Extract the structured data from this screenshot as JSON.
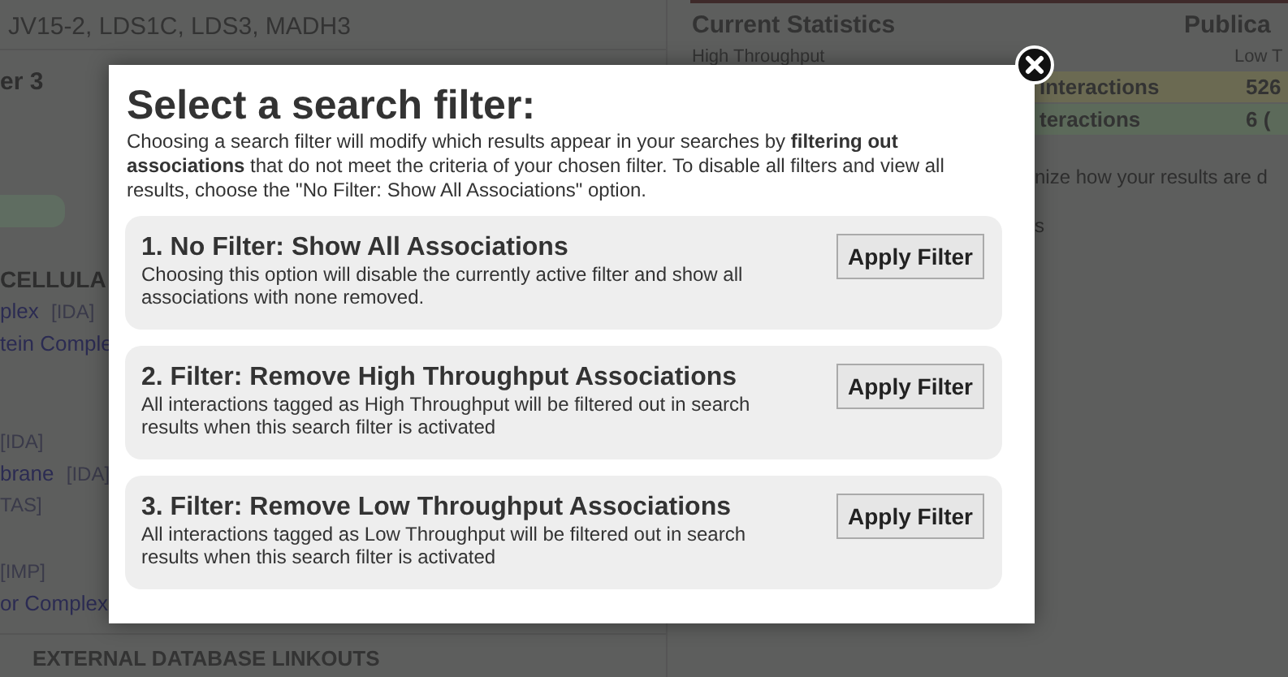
{
  "background": {
    "genes": "JV15-2, LDS1C, LDS3, MADH3",
    "section_fragment": "er 3",
    "ontology_heading": "CELLULA",
    "terms": [
      {
        "term": "plex",
        "evidence": "[IDA]"
      },
      {
        "term": "tein Comple"
      },
      {
        "evidence": "[IDA]"
      },
      {
        "term": "brane",
        "evidence": "[IDA]"
      },
      {
        "evidence": "TAS]"
      },
      {
        "evidence": "[IMP]"
      },
      {
        "term": "or Complex"
      }
    ],
    "external_heading": "EXTERNAL DATABASE LINKOUTS",
    "stats": {
      "title": "Current Statistics",
      "publications": "Publica",
      "high_label": "High Throughput",
      "low_label": "Low T",
      "rows": [
        {
          "label": "Interactions",
          "value": "526",
          "color": "#6b6a52"
        },
        {
          "label": "teractions",
          "value": "6 (",
          "color": "#5c6a5a"
        }
      ],
      "note": "nize how your results are d",
      "fragment": "s"
    }
  },
  "dialog": {
    "title": "Select a search filter:",
    "intro": "Choosing a search filter will modify which results appear in your searches by **filtering out associations** that do not meet the criteria of your chosen filter. To disable all filters and view all results, choose the \"No Filter: Show All Associations\" option.",
    "filters": [
      {
        "title": "1. No Filter: Show All Associations",
        "description": "Choosing this option will disable the currently active filter and show all associations with none removed.",
        "button": "Apply Filter"
      },
      {
        "title": "2. Filter: Remove High Throughput Associations",
        "description": "All interactions tagged as High Throughput will be filtered out in search results when this search filter is activated",
        "button": "Apply Filter"
      },
      {
        "title": "3. Filter: Remove Low Throughput Associations",
        "description": "All interactions tagged as Low Throughput will be filtered out in search results when this search filter is activated",
        "button": "Apply Filter"
      }
    ]
  }
}
